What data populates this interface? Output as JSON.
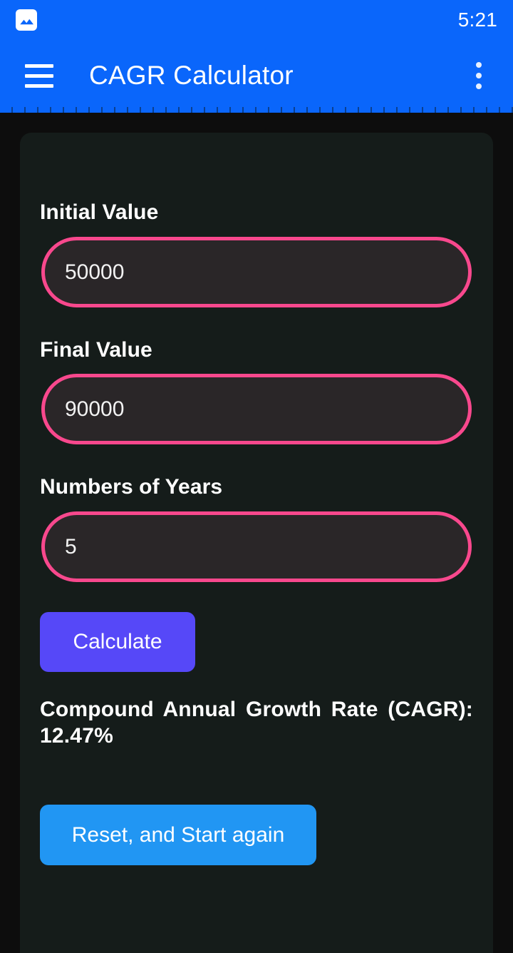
{
  "status_bar": {
    "time": "5:21",
    "icons": [
      "photo-icon"
    ]
  },
  "app_bar": {
    "title": "CAGR Calculator",
    "menu_icon": "hamburger-menu-icon",
    "overflow_icon": "more-vertical-icon",
    "background_color": "#0A66FB"
  },
  "form": {
    "fields": [
      {
        "label": "Initial Value",
        "value": "50000",
        "placeholder": ""
      },
      {
        "label": "Final Value",
        "value": "90000",
        "placeholder": ""
      },
      {
        "label": "Numbers of Years",
        "value": "5",
        "placeholder": ""
      }
    ],
    "calculate_label": "Calculate",
    "reset_label": "Reset, and Start again",
    "input_border_color": "#F8488D",
    "calculate_color": "#5648F8",
    "reset_color": "#2196F3"
  },
  "result": {
    "text": "Compound Annual Growth Rate (CAGR): 12.47%",
    "label": "Compound Annual Growth Rate (CAGR):",
    "value": "12.47%"
  },
  "theme": {
    "page_background": "#0D0D0D",
    "card_background": "#151C1A",
    "input_background": "#2A2628",
    "text_color": "#FFFFFF"
  }
}
